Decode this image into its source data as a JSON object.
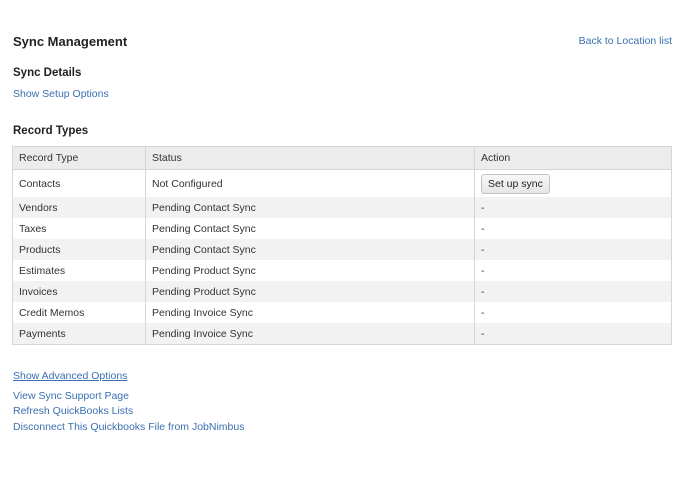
{
  "header": {
    "title": "Sync Management",
    "back_link": "Back to Location list"
  },
  "sync_details": {
    "title": "Sync Details",
    "show_setup_link": "Show Setup Options"
  },
  "record_types": {
    "title": "Record Types",
    "columns": [
      "Record Type",
      "Status",
      "Action"
    ],
    "rows": [
      {
        "type": "Contacts",
        "status": "Not Configured",
        "action": "Set up sync"
      },
      {
        "type": "Vendors",
        "status": "Pending Contact Sync",
        "action": "-"
      },
      {
        "type": "Taxes",
        "status": "Pending Contact Sync",
        "action": "-"
      },
      {
        "type": "Products",
        "status": "Pending Contact Sync",
        "action": "-"
      },
      {
        "type": "Estimates",
        "status": "Pending Product Sync",
        "action": "-"
      },
      {
        "type": "Invoices",
        "status": "Pending Product Sync",
        "action": "-"
      },
      {
        "type": "Credit Memos",
        "status": "Pending Invoice Sync",
        "action": "-"
      },
      {
        "type": "Payments",
        "status": "Pending Invoice Sync",
        "action": "-"
      }
    ]
  },
  "footer_links": {
    "advanced": "Show Advanced Options",
    "support": "View Sync Support Page",
    "refresh": "Refresh QuickBooks Lists",
    "disconnect": "Disconnect This Quickbooks File from JobNimbus"
  },
  "colors": {
    "link": "#3a6fb0",
    "header_bg": "#ececec",
    "row_shade": "#f2f2f2"
  }
}
